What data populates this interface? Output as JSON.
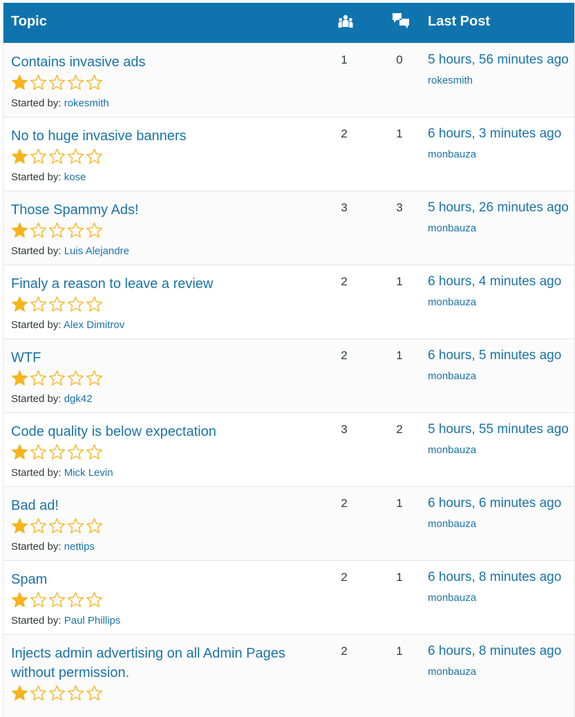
{
  "header": {
    "topic_label": "Topic",
    "voices_icon": "users-icon",
    "posts_icon": "replies-icon",
    "last_post_label": "Last Post"
  },
  "colors": {
    "header_bg": "#0f74ad",
    "link": "#1a73a9",
    "star": "#f6b31b"
  },
  "started_by_label": "Started by:",
  "topics": [
    {
      "title": "Contains invasive ads",
      "rating": 1,
      "author": "rokesmith",
      "voices": "1",
      "posts": "0",
      "last_time": "5 hours, 56 minutes ago",
      "last_author": "rokesmith"
    },
    {
      "title": "No to huge invasive banners",
      "rating": 1,
      "author": "kose",
      "voices": "2",
      "posts": "1",
      "last_time": "6 hours, 3 minutes ago",
      "last_author": "monbauza"
    },
    {
      "title": "Those Spammy Ads!",
      "rating": 1,
      "author": "Luis Alejandre",
      "voices": "3",
      "posts": "3",
      "last_time": "5 hours, 26 minutes ago",
      "last_author": "monbauza"
    },
    {
      "title": "Finaly a reason to leave a review",
      "rating": 1,
      "author": "Alex Dimitrov",
      "voices": "2",
      "posts": "1",
      "last_time": "6 hours, 4 minutes ago",
      "last_author": "monbauza"
    },
    {
      "title": "WTF",
      "rating": 1,
      "author": "dgk42",
      "voices": "2",
      "posts": "1",
      "last_time": "6 hours, 5 minutes ago",
      "last_author": "monbauza"
    },
    {
      "title": "Code quality is below expectation",
      "rating": 1,
      "author": "Mick Levin",
      "voices": "3",
      "posts": "2",
      "last_time": "5 hours, 55 minutes ago",
      "last_author": "monbauza"
    },
    {
      "title": "Bad ad!",
      "rating": 1,
      "author": "nettips",
      "voices": "2",
      "posts": "1",
      "last_time": "6 hours, 6 minutes ago",
      "last_author": "monbauza"
    },
    {
      "title": "Spam",
      "rating": 1,
      "author": "Paul Phillips",
      "voices": "2",
      "posts": "1",
      "last_time": "6 hours, 8 minutes ago",
      "last_author": "monbauza"
    },
    {
      "title": "Injects admin advertising on all Admin Pages without permission.",
      "rating": 1,
      "author": "",
      "voices": "2",
      "posts": "1",
      "last_time": "6 hours, 8 minutes ago",
      "last_author": "monbauza"
    }
  ]
}
